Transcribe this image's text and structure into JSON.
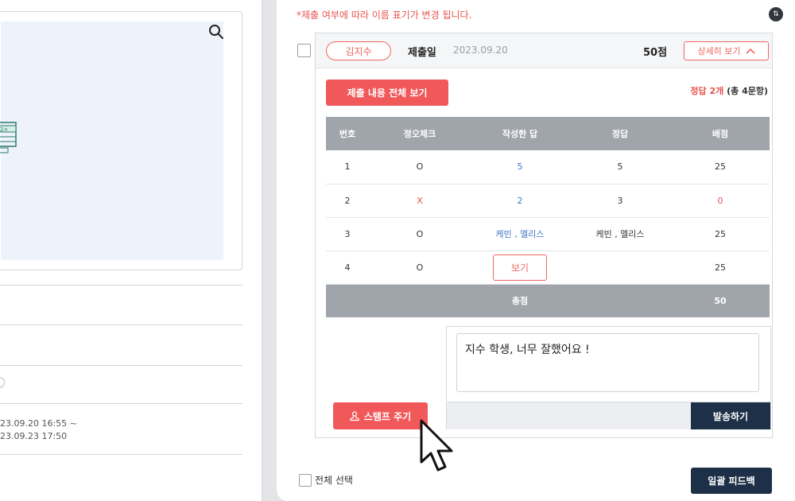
{
  "left_panel": {
    "date_range_start": "23.09.20 16:55 ~",
    "date_range_end": "23.09.23 17:50"
  },
  "submission": {
    "notice": "*제출 여부에 따라 이름 표기가 변경 됩니다.",
    "student_name": "김지수",
    "submit_label": "제출일",
    "submit_date": "2023.09.20",
    "score": "50점",
    "detail_button": "상세히 보기",
    "view_all_button": "제출 내용 전체 보기",
    "correct_count": "정답 2개",
    "question_total": "(총 4문항)"
  },
  "grade_table": {
    "columns": [
      "번호",
      "정오체크",
      "작성한 답",
      "정답",
      "배점"
    ],
    "rows": [
      {
        "no": "1",
        "check": "O",
        "answer": "5",
        "correct": "5",
        "points": "25"
      },
      {
        "no": "2",
        "check": "X",
        "answer": "2",
        "correct": "3",
        "points": "0"
      },
      {
        "no": "3",
        "check": "O",
        "answer": "케빈 , 엘리스",
        "correct": "케빈 , 엘리스",
        "points": "25"
      },
      {
        "no": "4",
        "check": "O",
        "answer_button": "보기",
        "correct": "",
        "points": "25"
      }
    ],
    "total_label": "총점",
    "total_value": "50"
  },
  "feedback": {
    "text": "지수 학생, 너무 잘했어요 !",
    "send_button": "발송하기",
    "stamp_button": "스탬프 주기"
  },
  "footer": {
    "select_all": "전체 선택",
    "bulk_feedback": "일괄 피드백"
  },
  "colors": {
    "accent": "#f0585a",
    "navy": "#1e3047",
    "table_header": "#a0a4ab",
    "link_blue": "#3f77c8"
  }
}
